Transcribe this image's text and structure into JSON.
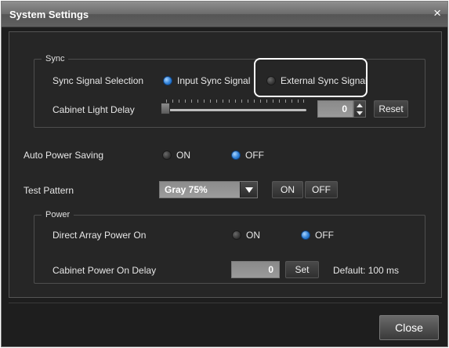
{
  "window": {
    "title": "System Settings",
    "close_glyph": "×"
  },
  "sync": {
    "legend": "Sync",
    "selection_label": "Sync Signal Selection",
    "options": [
      {
        "label": "Input Sync Signal",
        "selected": true
      },
      {
        "label": "External Sync Signal",
        "selected": false
      }
    ],
    "cabinet_light_delay_label": "Cabinet Light Delay",
    "cabinet_light_delay_value": "0",
    "reset_label": "Reset"
  },
  "auto_power_saving": {
    "label": "Auto Power Saving",
    "on_label": "ON",
    "off_label": "OFF",
    "selected": "OFF"
  },
  "test_pattern": {
    "label": "Test Pattern",
    "selected": "Gray 75%",
    "on_label": "ON",
    "off_label": "OFF"
  },
  "power": {
    "legend": "Power",
    "direct_array_label": "Direct Array Power On",
    "on_label": "ON",
    "off_label": "OFF",
    "selected": "OFF",
    "cabinet_power_on_delay_label": "Cabinet Power On Delay",
    "cabinet_power_on_delay_value": "0",
    "set_label": "Set",
    "default_text": "Default: 100 ms"
  },
  "footer": {
    "close_label": "Close"
  },
  "colors": {
    "accent_radio": "#2e7fd6",
    "background": "#262626",
    "title_bar": "#6b6b6b"
  }
}
